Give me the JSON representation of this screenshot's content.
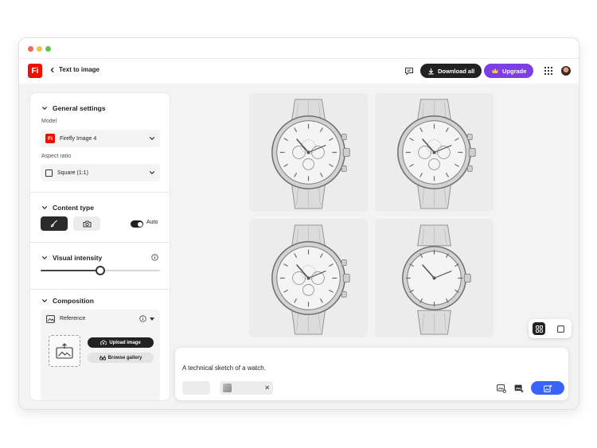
{
  "header": {
    "back_label": "Text to image",
    "download_label": "Download all",
    "upgrade_label": "Upgrade",
    "logo_text": "Fi"
  },
  "colors": {
    "brand": "#eb1000",
    "upgrade": "#7b3fe4",
    "generate": "#3b63fb"
  },
  "general": {
    "title": "General settings",
    "model_label": "Model",
    "model_value": "Firefly Image 4",
    "model_icon_text": "Fi",
    "aspect_label": "Aspect ratio",
    "aspect_value": "Square (1:1)"
  },
  "content_type": {
    "title": "Content type",
    "auto_label": "Auto",
    "options": [
      "art-brush-icon",
      "camera-icon"
    ],
    "selected": "art",
    "auto_on": true
  },
  "visual_intensity": {
    "title": "Visual intensity",
    "value_fraction": 0.5
  },
  "composition": {
    "title": "Composition",
    "reference_label": "Reference",
    "upload_label": "Upload image",
    "browse_label": "Browse gallery"
  },
  "gallery": {
    "images": [
      {
        "name": "generated-image-1",
        "subject": "watch sketch"
      },
      {
        "name": "generated-image-2",
        "subject": "watch sketch"
      },
      {
        "name": "generated-image-3",
        "subject": "watch sketch"
      },
      {
        "name": "generated-image-4",
        "subject": "watch sketch"
      }
    ],
    "view": "grid"
  },
  "prompt": {
    "text": "A technical sketch of a watch."
  }
}
